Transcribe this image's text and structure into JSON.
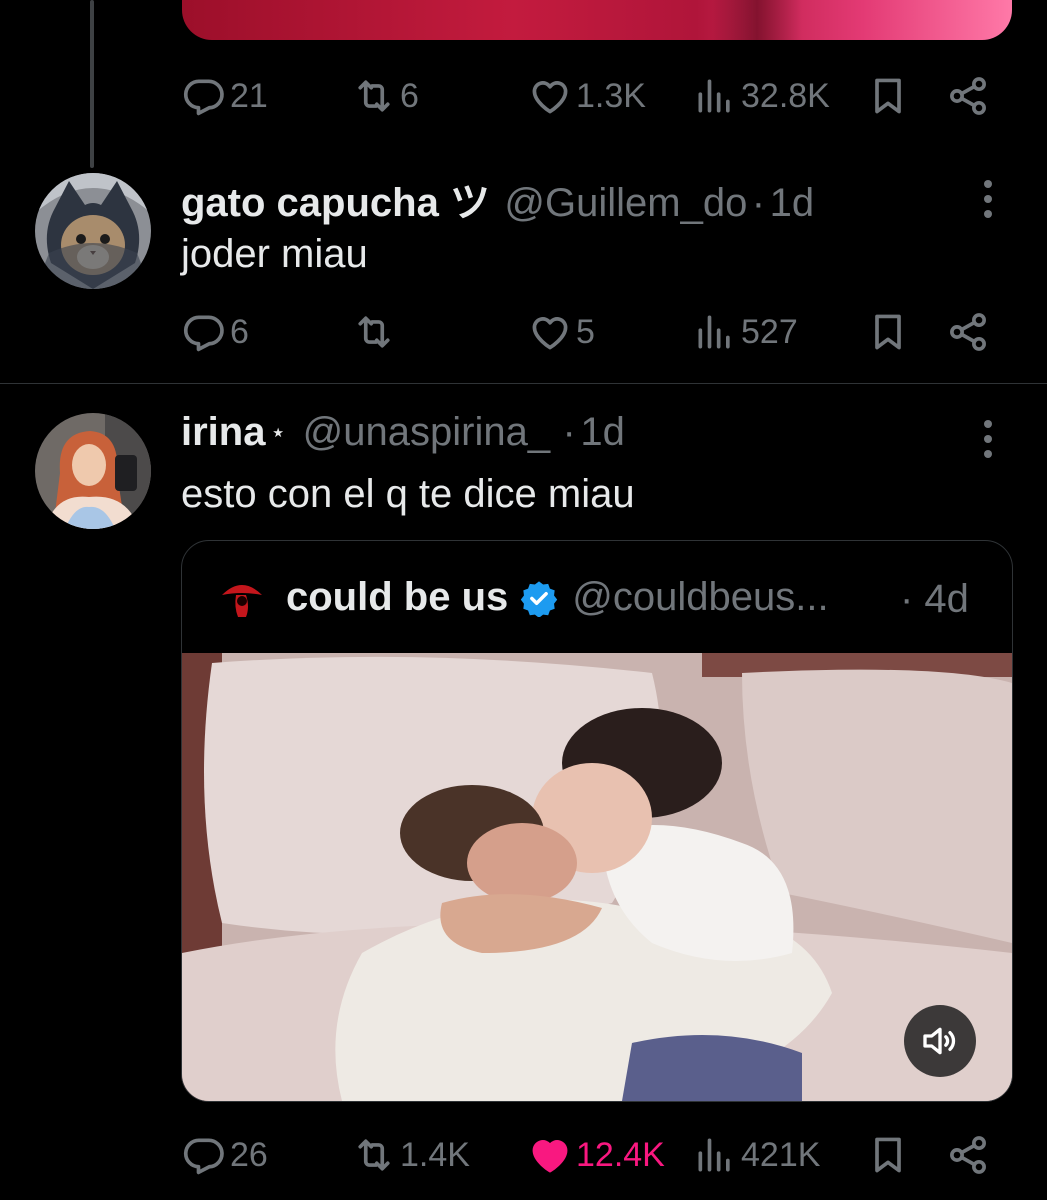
{
  "tweet_prev": {
    "replies": "21",
    "retweets": "6",
    "likes": "1.3K",
    "views": "32.8K"
  },
  "tweet1": {
    "name": "gato capucha ツ",
    "handle": "@Guillem_do",
    "separator": "·",
    "time": "1d",
    "text": "joder miau",
    "replies": "6",
    "retweets": "",
    "likes": "5",
    "views": "527"
  },
  "tweet2": {
    "name": "irina",
    "name_star": "⋆",
    "handle": "@unaspirina_",
    "separator": "·",
    "time": "1d",
    "text": "esto con el q te dice miau",
    "quote": {
      "name": "could be us",
      "handle": "@couldbeus...",
      "time": "· 4d"
    },
    "replies": "26",
    "retweets": "1.4K",
    "likes": "12.4K",
    "views": "421K"
  },
  "colors": {
    "background": "#000000",
    "text_primary": "#e7e9ea",
    "text_secondary": "#71767b",
    "like_active": "#f91880",
    "verified": "#1d9bf0",
    "divider": "#2f3336"
  },
  "icons": [
    "reply-icon",
    "retweet-icon",
    "like-icon",
    "views-icon",
    "bookmark-icon",
    "share-icon",
    "more-icon",
    "verified-icon",
    "volume-icon"
  ]
}
